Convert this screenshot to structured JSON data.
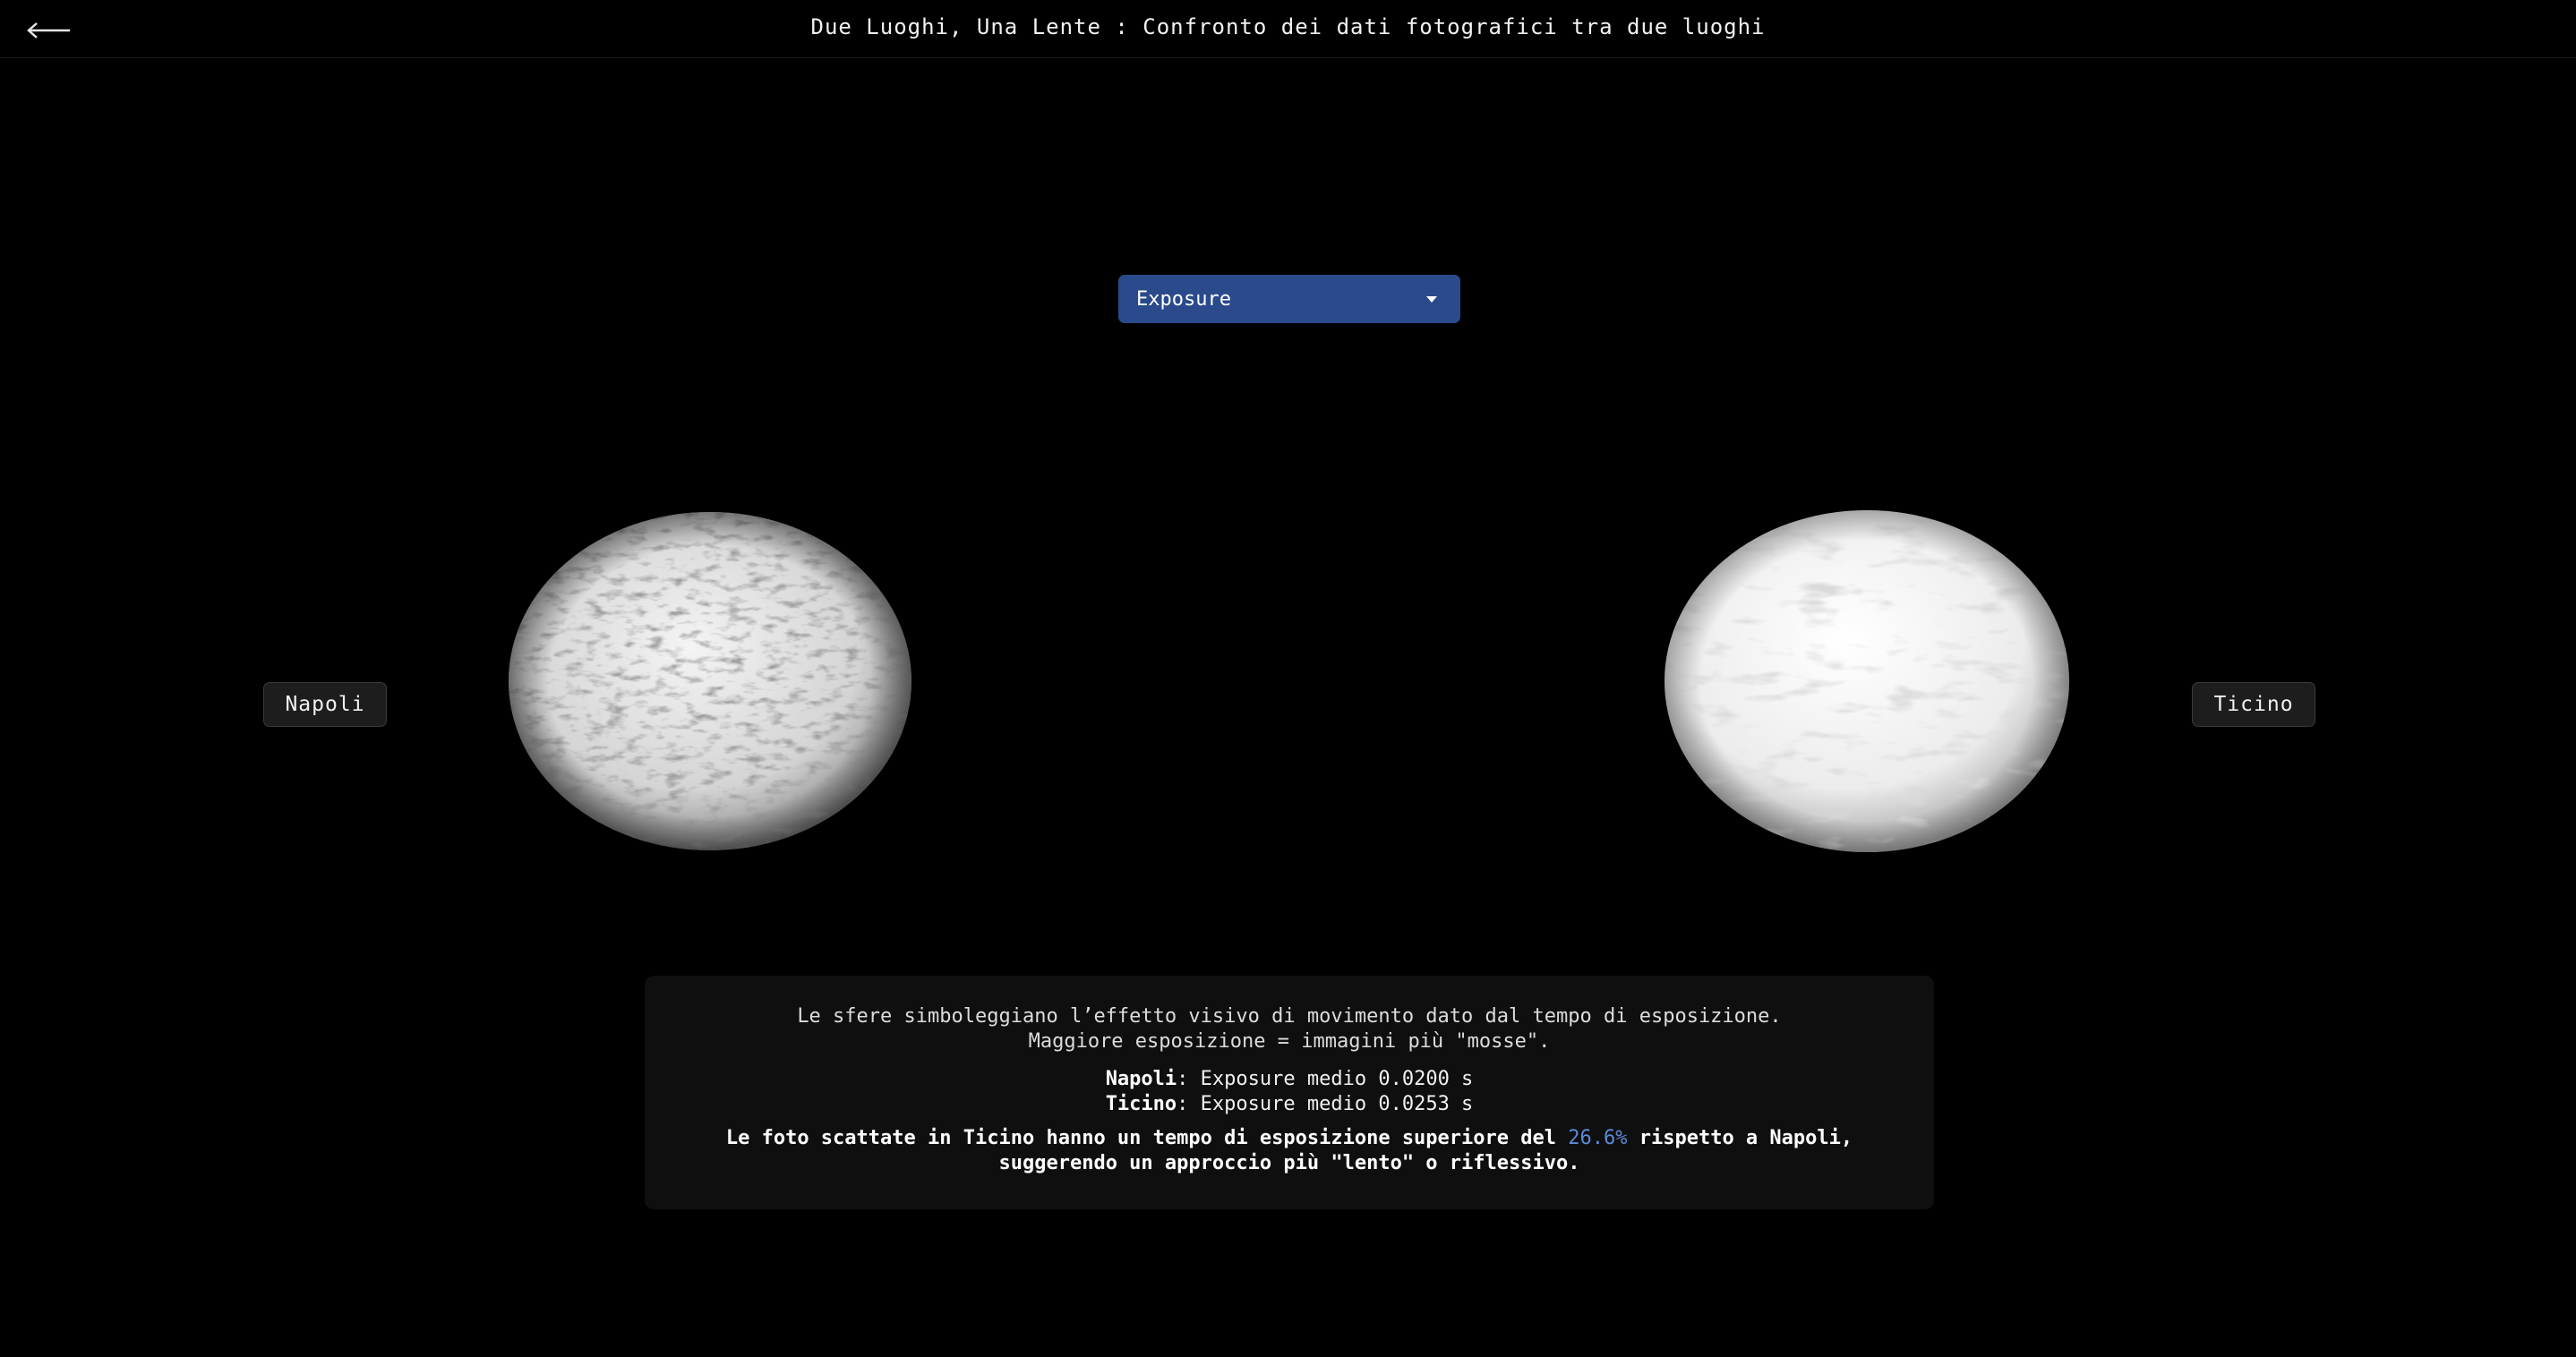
{
  "header": {
    "title": "Due Luoghi, Una Lente : Confronto dei dati fotografici tra due luoghi",
    "back_icon": "arrow-left-icon"
  },
  "metric_select": {
    "selected": "Exposure",
    "icon": "caret-down-icon",
    "color": "#2a4a8c"
  },
  "places": {
    "left": {
      "label": "Napoli"
    },
    "right": {
      "label": "Ticino"
    }
  },
  "info": {
    "line1": "Le sfere simboleggiano l’effetto visivo di movimento dato dal tempo di esposizione.",
    "line2": "Maggiore esposizione = immagini più \"mosse\".",
    "stat_napoli_name": "Napoli",
    "stat_napoli_value": ": Exposure medio 0.0200 s",
    "stat_ticino_name": "Ticino",
    "stat_ticino_value": ": Exposure medio 0.0253 s",
    "conclusion_pre": "Le foto scattate in Ticino hanno un tempo di esposizione superiore del ",
    "conclusion_pct": "26.6%",
    "conclusion_post": " rispetto a Napoli, suggerendo un approccio più \"lento\" o riflessivo.",
    "accent_color": "#5b8ad6"
  }
}
